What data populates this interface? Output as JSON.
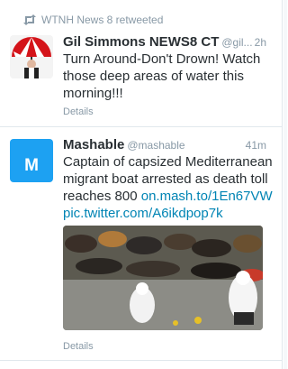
{
  "retweet": {
    "icon": "retweet-icon",
    "text": "WTNH News 8 retweeted"
  },
  "tweets": [
    {
      "name": "Gil Simmons NEWS8 CT",
      "handle": "@gil...",
      "time": "2h",
      "text": "Turn Around-Don't Drown! Watch those deep areas of water this morning!!!",
      "details": "Details",
      "avatar_icon": "umbrella-avatar"
    },
    {
      "name": "Mashable",
      "handle": "@mashable",
      "time": "41m",
      "text": "Captain of capsized Mediterranean migrant boat arrested as death toll reaches 800 ",
      "link1": "on.mash.to/1En67VW",
      "link2": "pic.twitter.com/A6ikdpop7k",
      "details": "Details",
      "avatar_letter": "M",
      "avatar_color": "#1da1f2"
    }
  ],
  "colors": {
    "link": "#0084b4",
    "muted": "#8899a6",
    "text": "#292f33",
    "border": "#e1e8ed"
  }
}
